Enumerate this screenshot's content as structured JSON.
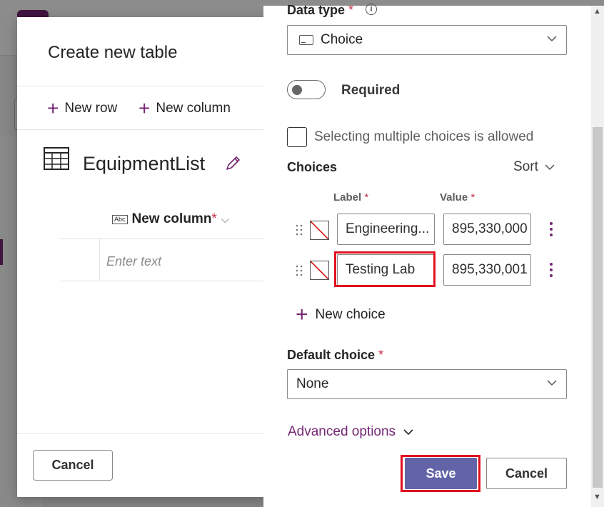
{
  "dialog": {
    "title": "Create new table",
    "commands": [
      {
        "label": "New row"
      },
      {
        "label": "New column"
      }
    ],
    "table_name": "EquipmentList",
    "column": {
      "header": "New column",
      "required_mark": "*",
      "placeholder": "Enter text",
      "type_icon_text": "Abc"
    },
    "cancel_label": "Cancel"
  },
  "panel": {
    "data_type": {
      "label": "Data type",
      "required_mark": "*",
      "value": "Choice"
    },
    "required": {
      "label": "Required",
      "on": false
    },
    "multi_select": {
      "label": "Selecting multiple choices is allowed",
      "checked": false
    },
    "choices": {
      "label": "Choices",
      "sort_label": "Sort",
      "label_header": "Label",
      "value_header": "Value",
      "required_mark": "*",
      "items": [
        {
          "label": "Engineering...",
          "value": "895,330,000"
        },
        {
          "label": "Testing Lab",
          "value": "895,330,001"
        }
      ],
      "new_choice_label": "New choice"
    },
    "default_choice": {
      "label": "Default choice",
      "required_mark": "*",
      "value": "None"
    },
    "advanced_options_label": "Advanced options",
    "save_label": "Save",
    "cancel_label": "Cancel"
  },
  "colors": {
    "accent": "#742774",
    "primary_button": "#6264a7",
    "highlight_border": "#e0121f",
    "required_star": "#c4314b"
  }
}
